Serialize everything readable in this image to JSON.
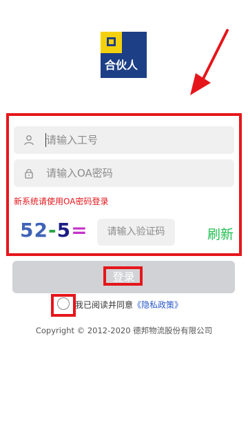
{
  "logo": {
    "text": "合伙人"
  },
  "form": {
    "employee_id_placeholder": "请输入工号",
    "password_placeholder": "请输入OA密码",
    "hint": "新系统请使用OA密码登录",
    "captcha": {
      "part1": "52",
      "op": "-",
      "part2": "5",
      "eq": "="
    },
    "captcha_placeholder": "请输入验证码",
    "refresh_label": "刷新"
  },
  "login_button": {
    "label": "登录"
  },
  "agreement": {
    "text": "我已阅读并同意",
    "link": "《隐私政策》"
  },
  "footer": {
    "copyright": "Copyright © 2012-2020 德邦物流股份有限公司"
  },
  "colors": {
    "brand_blue": "#1d3f86",
    "brand_yellow": "#f4d10f",
    "highlight_red": "#e5161b",
    "refresh_green": "#1fbf4f"
  }
}
